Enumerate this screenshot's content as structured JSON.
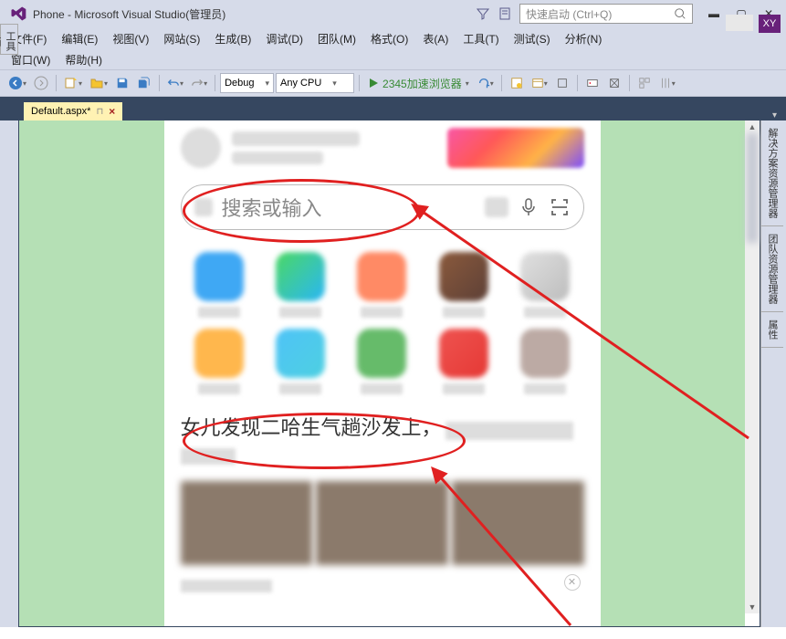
{
  "titlebar": {
    "title": "Phone - Microsoft Visual Studio(管理员)",
    "quick_launch_placeholder": "快速启动 (Ctrl+Q)"
  },
  "menubar": {
    "file": "文件(F)",
    "edit": "编辑(E)",
    "view": "视图(V)",
    "website": "网站(S)",
    "build": "生成(B)",
    "debug": "调试(D)",
    "team": "团队(M)",
    "format": "格式(O)",
    "table": "表(A)",
    "tools": "工具(T)",
    "test": "测试(S)",
    "analyze": "分析(N)",
    "window": "窗口(W)",
    "help": "帮助(H)"
  },
  "xy_badge": "XY",
  "toolbar": {
    "config": "Debug",
    "platform": "Any CPU",
    "run_label": "2345加速浏览器"
  },
  "tabs": {
    "active": "Default.aspx*"
  },
  "left_panel": "工具箱",
  "right_panels": [
    "解决方案资源管理器",
    "团队资源管理器",
    "属性"
  ],
  "phone": {
    "search_placeholder": "搜索或输入",
    "app_colors": [
      "#3fa8f4",
      "linear-gradient(135deg,#4bd863,#29b6f6)",
      "#ff8a65",
      "linear-gradient(135deg,#8b5a3c,#5d4037)",
      "linear-gradient(135deg,#e0e0e0,#bdbdbd)",
      "#ffb74d",
      "linear-gradient(135deg,#4fc3f7,#4dd0e1)",
      "#66bb6a",
      "linear-gradient(135deg,#ef5350,#e53935)",
      "#bcaaa4"
    ],
    "news_title": "女儿发现二哈生气趟沙发上，"
  }
}
